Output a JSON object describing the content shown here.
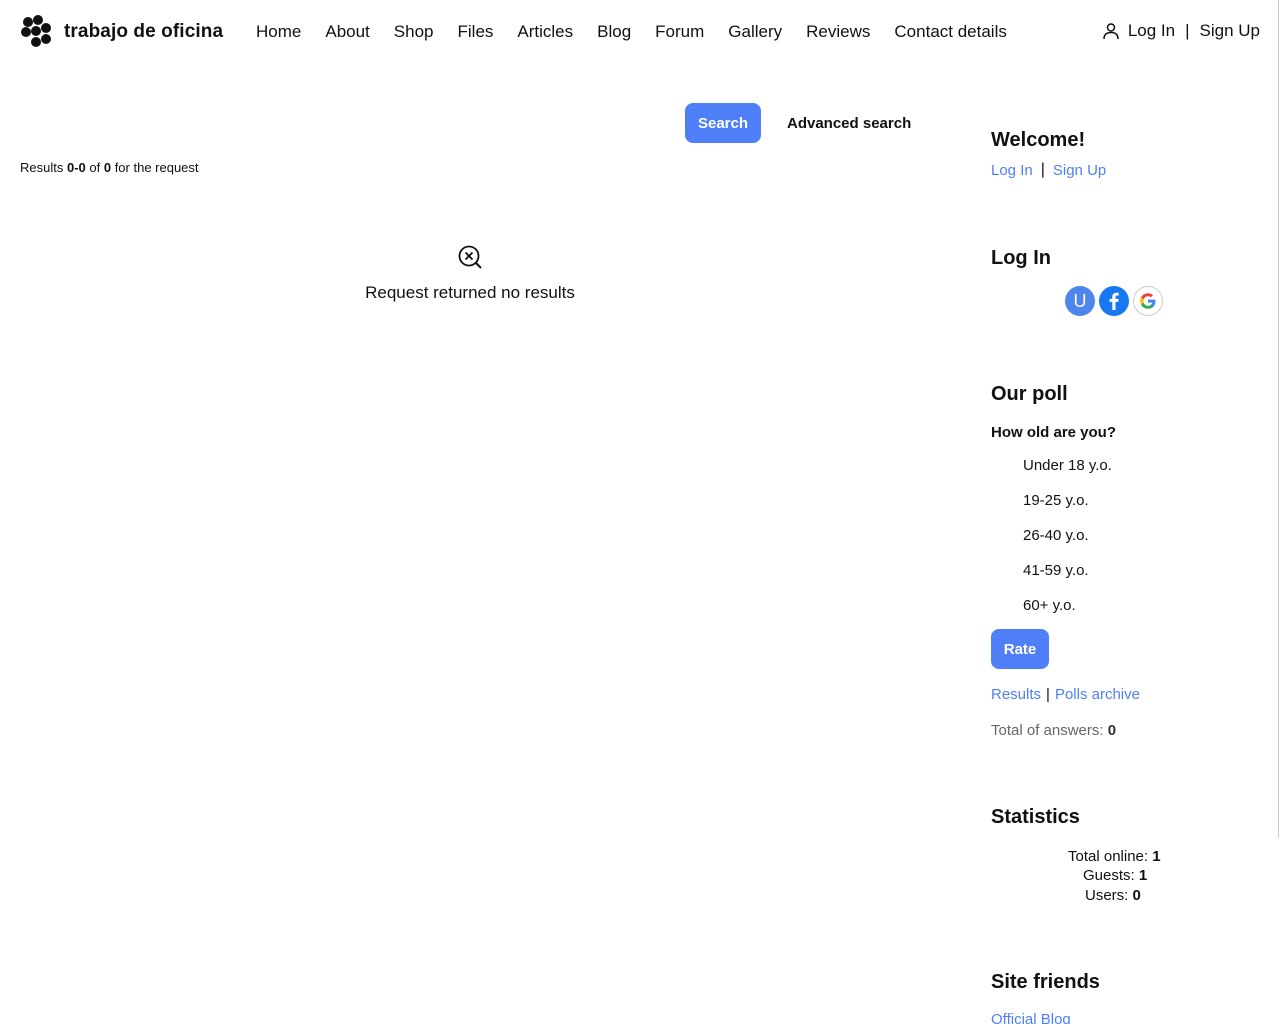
{
  "header": {
    "site_title": "trabajo de oficina",
    "nav": [
      "Home",
      "About",
      "Shop",
      "Files",
      "Articles",
      "Blog",
      "Forum",
      "Gallery",
      "Reviews",
      "Contact details"
    ],
    "login": "Log In",
    "signup": "Sign Up"
  },
  "search": {
    "button_label": "Search",
    "advanced_label": "Advanced search",
    "results_prefix": "Results ",
    "results_range": "0-0",
    "results_of": " of ",
    "results_total": "0",
    "results_suffix": " for the request",
    "no_results": "Request returned no results"
  },
  "sidebar": {
    "welcome": {
      "title": "Welcome!",
      "login": "Log In",
      "signup": "Sign Up"
    },
    "login_block": {
      "title": "Log In",
      "user_letter": "U"
    },
    "poll": {
      "title": "Our poll",
      "question": "How old are you?",
      "options": [
        "Under 18 y.o.",
        "19-25 y.o.",
        "26-40 y.o.",
        "41-59 y.o.",
        "60+ y.o."
      ],
      "rate_label": "Rate",
      "results_link": "Results",
      "archive_link": "Polls archive",
      "total_label": "Total of answers: ",
      "total_value": "0"
    },
    "statistics": {
      "title": "Statistics",
      "total_online_label": "Total online: ",
      "total_online": "1",
      "guests_label": "Guests: ",
      "guests": "1",
      "users_label": "Users: ",
      "users": "0"
    },
    "friends": {
      "title": "Site friends",
      "first_link": "Official Blog"
    }
  },
  "colors": {
    "accent": "#4f7ff6",
    "facebook": "#1877f2"
  }
}
